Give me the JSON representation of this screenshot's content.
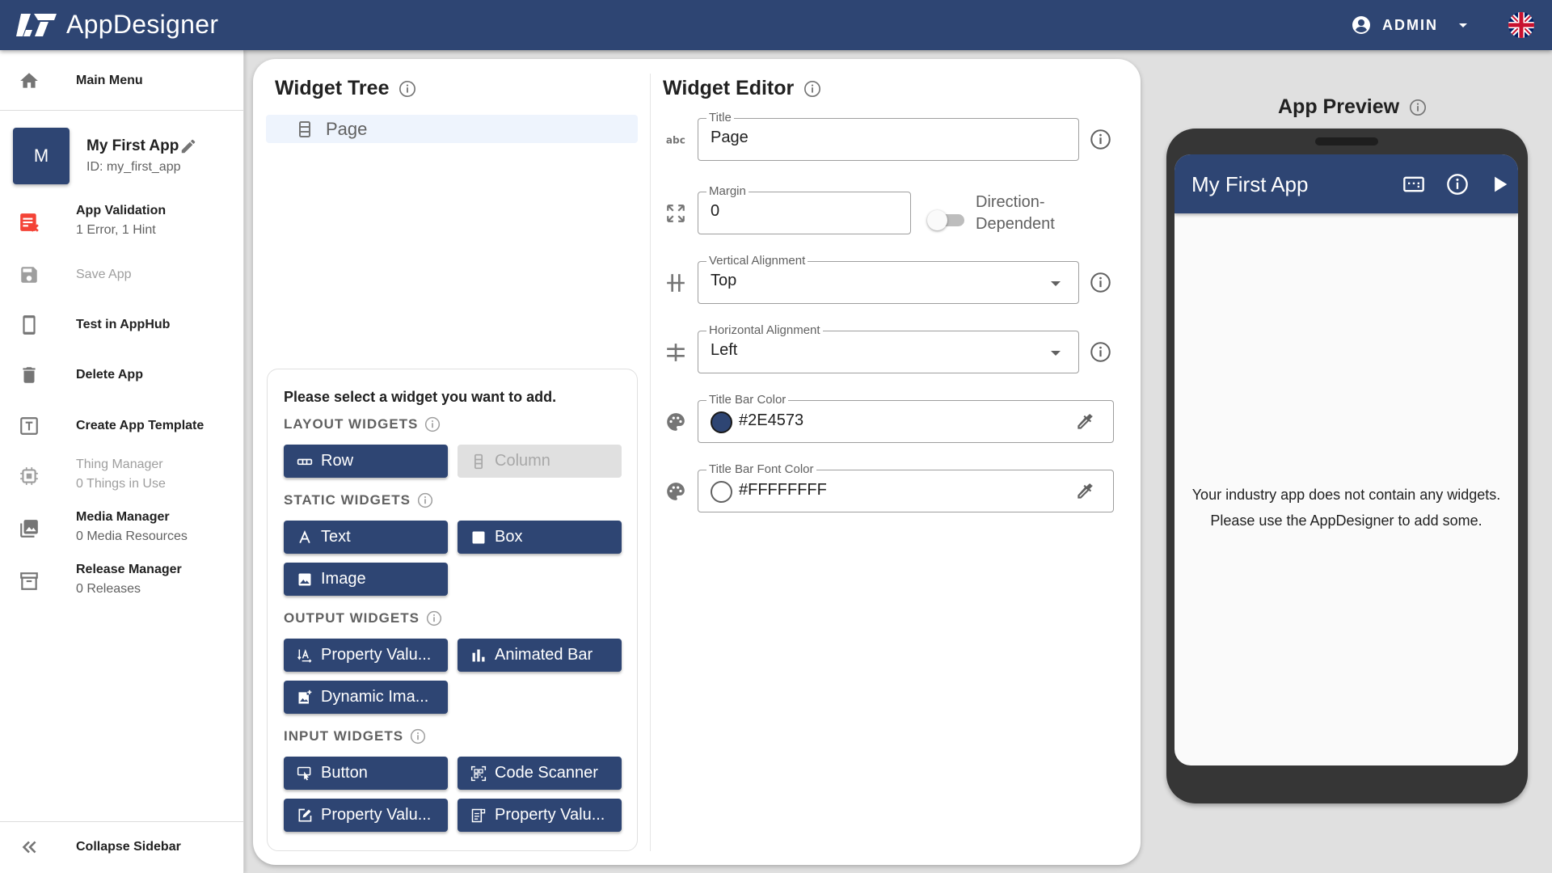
{
  "header": {
    "app_name": "AppDesigner",
    "user": "ADMIN",
    "language": "English (UK)"
  },
  "sidebar": {
    "main_menu": "Main Menu",
    "app": {
      "avatar_letter": "M",
      "name": "My First App",
      "id": "ID: my_first_app"
    },
    "items": [
      {
        "title": "App Validation",
        "subtitle": "1 Error, 1 Hint",
        "icon": "validation-error-icon"
      },
      {
        "title": "Save App",
        "icon": "save-icon",
        "disabled": true
      },
      {
        "title": "Test in AppHub",
        "icon": "phone-icon"
      },
      {
        "title": "Delete App",
        "icon": "trash-icon"
      },
      {
        "title": "Create App Template",
        "icon": "template-icon"
      },
      {
        "title": "Thing Manager",
        "subtitle": "0 Things in Use",
        "icon": "chip-icon",
        "disabled": true
      },
      {
        "title": "Media Manager",
        "subtitle": "0 Media Resources",
        "icon": "media-icon"
      },
      {
        "title": "Release Manager",
        "subtitle": "0 Releases",
        "icon": "archive-icon"
      }
    ],
    "collapse": "Collapse Sidebar"
  },
  "widget_tree": {
    "title": "Widget Tree",
    "nodes": [
      {
        "label": "Page",
        "selected": true
      }
    ]
  },
  "widget_picker": {
    "hint": "Please select a widget you want to add.",
    "groups": [
      {
        "label": "LAYOUT WIDGETS",
        "widgets": [
          {
            "label": "Row"
          },
          {
            "label": "Column",
            "disabled": true
          }
        ]
      },
      {
        "label": "STATIC WIDGETS",
        "widgets": [
          {
            "label": "Text"
          },
          {
            "label": "Box"
          },
          {
            "label": "Image"
          }
        ]
      },
      {
        "label": "OUTPUT WIDGETS",
        "widgets": [
          {
            "label": "Property Valu..."
          },
          {
            "label": "Animated Bar"
          },
          {
            "label": "Dynamic Ima..."
          }
        ]
      },
      {
        "label": "INPUT WIDGETS",
        "widgets": [
          {
            "label": "Button"
          },
          {
            "label": "Code Scanner"
          },
          {
            "label": "Property Valu..."
          },
          {
            "label": "Property Valu..."
          }
        ]
      }
    ]
  },
  "widget_editor": {
    "title": "Widget Editor",
    "fields": {
      "title": {
        "label": "Title",
        "value": "Page"
      },
      "margin": {
        "label": "Margin",
        "value": "0"
      },
      "direction_dependent": {
        "label": "Direction-Dependent",
        "on": false
      },
      "vertical_alignment": {
        "label": "Vertical Alignment",
        "value": "Top"
      },
      "horizontal_alignment": {
        "label": "Horizontal Alignment",
        "value": "Left"
      },
      "title_bar_color": {
        "label": "Title Bar Color",
        "value": "#2E4573",
        "swatch": "#2E4573"
      },
      "title_bar_font_color": {
        "label": "Title Bar Font Color",
        "value": "#FFFFFFFF",
        "swatch": "#FFFFFF"
      }
    }
  },
  "preview": {
    "title": "App Preview",
    "app_title": "My First App",
    "empty_line1": "Your industry app does not contain any widgets.",
    "empty_line2": "Please use the AppDesigner to add some."
  },
  "colors": {
    "brand": "#2E4573",
    "error": "#F44336"
  }
}
